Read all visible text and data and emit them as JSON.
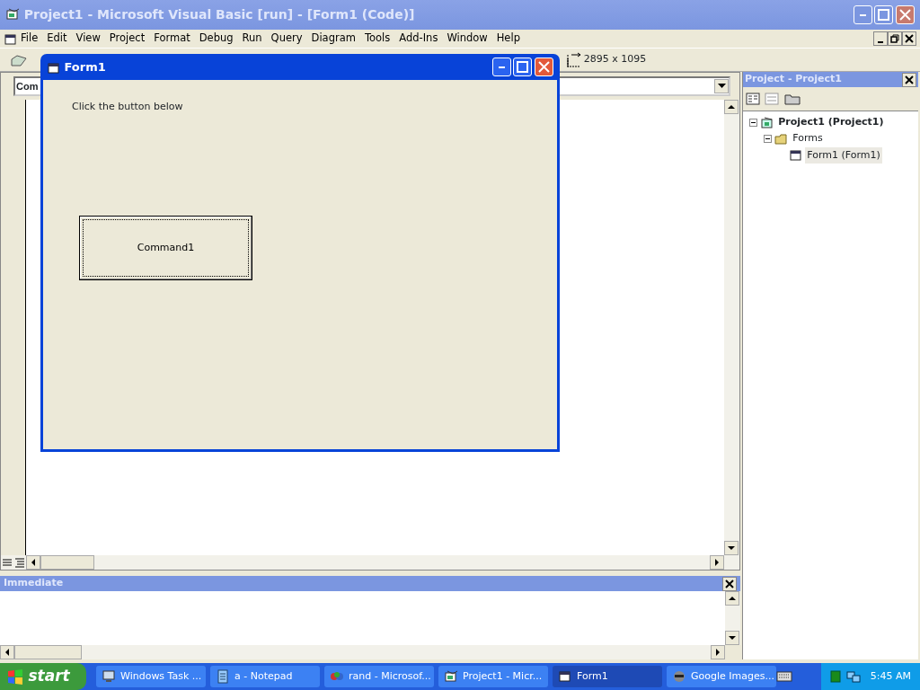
{
  "window": {
    "title": "Project1 - Microsoft Visual Basic [run] - [Form1 (Code)]"
  },
  "menu": [
    {
      "label": "File"
    },
    {
      "label": "Edit"
    },
    {
      "label": "View"
    },
    {
      "label": "Project"
    },
    {
      "label": "Format"
    },
    {
      "label": "Debug"
    },
    {
      "label": "Run"
    },
    {
      "label": "Query"
    },
    {
      "label": "Diagram"
    },
    {
      "label": "Tools"
    },
    {
      "label": "Add-Ins"
    },
    {
      "label": "Window"
    },
    {
      "label": "Help"
    }
  ],
  "toolbar": {
    "size_readout": "2895 x 1095"
  },
  "code_window": {
    "object_combo": "Com"
  },
  "project_panel": {
    "title": "Project - Project1",
    "tree": [
      {
        "label": "Project1 (Project1)",
        "kind": "project",
        "expanded": true,
        "selected": false,
        "children": [
          {
            "label": "Forms",
            "kind": "folder",
            "expanded": true,
            "selected": false,
            "children": [
              {
                "label": "Form1 (Form1)",
                "kind": "form",
                "selected": true
              }
            ]
          }
        ]
      }
    ]
  },
  "immediate": {
    "title": "Immediate"
  },
  "form_window": {
    "title": "Form1",
    "label": "Click the button below",
    "button": "Command1"
  },
  "taskbar": {
    "start": "start",
    "tasks": [
      {
        "label": "Windows Task ...",
        "kind": "monitor",
        "selected": false
      },
      {
        "label": "a - Notepad",
        "kind": "notepad",
        "selected": false
      },
      {
        "label": "rand - Microsof...",
        "kind": "palette",
        "selected": false
      },
      {
        "label": "Project1 - Micr...",
        "kind": "vb",
        "selected": false
      },
      {
        "label": "Form1",
        "kind": "form",
        "selected": true
      },
      {
        "label": "Google Images...",
        "kind": "raccoon",
        "selected": false
      }
    ],
    "clock": "5:45 AM"
  }
}
